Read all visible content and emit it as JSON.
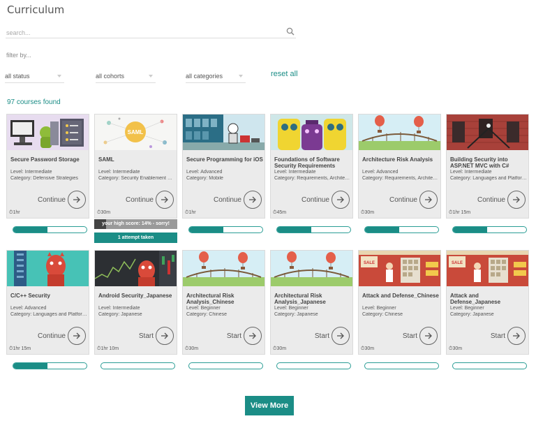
{
  "page": {
    "title": "Curriculum"
  },
  "search": {
    "placeholder": "search..."
  },
  "filters": {
    "label": "filter by...",
    "status": "all status",
    "cohorts": "all cohorts",
    "categories": "all categories",
    "reset": "reset all"
  },
  "results": {
    "count_text": "97 courses found"
  },
  "courses": [
    {
      "title": "Secure Password Storage",
      "level": "Level: Intermediate",
      "category": "Category: Defensive Strategies",
      "action": "Continue",
      "time": "⏱1hr",
      "progress": 0.47,
      "thumb": "password"
    },
    {
      "title": "SAML",
      "level": "Level: Intermediate",
      "category": "Category: Security Enablement Serv...",
      "action": "Continue",
      "time": "⏱30m",
      "progress": 0.14,
      "thumb": "saml",
      "score_text": "your high score: 14% - sorry!",
      "attempt_text": "1 attempt taken"
    },
    {
      "title": "Secure Programming for iOS",
      "level": "Level: Advanced",
      "category": "Category: Mobile",
      "action": "Continue",
      "time": "⏱1hr",
      "progress": 0.47,
      "thumb": "ios"
    },
    {
      "title": "Foundations of Software Security Requirements",
      "level": "Level: Intermediate",
      "category": "Category: Requirements, Architectu...",
      "action": "Continue",
      "time": "⏱45m",
      "progress": 0.47,
      "thumb": "robots"
    },
    {
      "title": "Architecture Risk Analysis",
      "level": "Level: Advanced",
      "category": "Category: Requirements, Architectu...",
      "action": "Continue",
      "time": "⏱30m",
      "progress": 0.47,
      "thumb": "balloons"
    },
    {
      "title": "Building Security into ASP.NET MVC with C#",
      "level": "Level: Intermediate",
      "category": "Category: Languages and Platforms",
      "action": "Continue",
      "time": "⏱1hr 15m",
      "progress": 0.47,
      "thumb": "brick"
    },
    {
      "title": "C/C++ Security",
      "level": "Level: Advanced",
      "category": "Category: Languages and Platforms",
      "action": "Continue",
      "time": "⏱1hr 15m",
      "progress": 0.47,
      "thumb": "devil"
    },
    {
      "title": "Android Security_Japanese",
      "level": "Level: Intermediate",
      "category": "Category: Japanese",
      "action": "Start",
      "time": "⏱1hr 10m",
      "progress": 0,
      "thumb": "android"
    },
    {
      "title": "Architectural Risk Analysis_Chinese",
      "level": "Level: Beginner",
      "category": "Category: Chinese",
      "action": "Start",
      "time": "⏱30m",
      "progress": 0,
      "thumb": "balloons"
    },
    {
      "title": "Architectural Risk Analysis_Japanese",
      "level": "Level: Beginner",
      "category": "Category: Japanese",
      "action": "Start",
      "time": "⏱30m",
      "progress": 0,
      "thumb": "balloons"
    },
    {
      "title": "Attack and Defense_Chinese",
      "level": "Level: Beginner",
      "category": "Category: Chinese",
      "action": "Start",
      "time": "⏱30m",
      "progress": 0,
      "thumb": "shop"
    },
    {
      "title": "Attack and Defense_Japanese",
      "level": "Level: Beginner",
      "category": "Category: Japanese",
      "action": "Start",
      "time": "⏱30m",
      "progress": 0,
      "thumb": "shop"
    }
  ],
  "thumb_labels": {
    "saml": "SAML",
    "sale": "SALE"
  },
  "view_more": "View More",
  "colors": {
    "accent": "#1b8d86",
    "card_bg": "#ebebeb"
  }
}
